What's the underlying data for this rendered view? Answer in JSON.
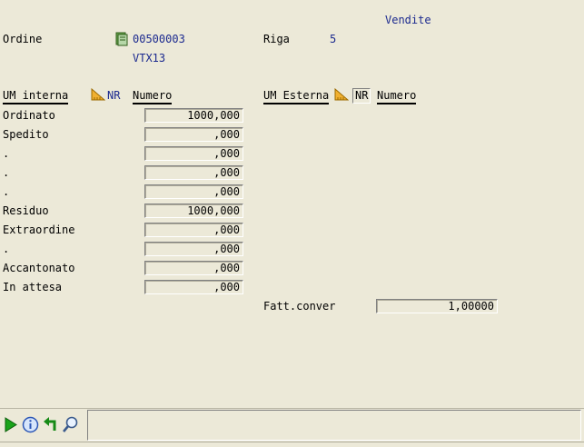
{
  "header": {
    "sales_label": "Vendite",
    "order_label": "Ordine",
    "order_number": "00500003",
    "order_code": "VTX13",
    "row_label": "Riga",
    "row_value": "5"
  },
  "columns": {
    "um_internal": "UM interna",
    "um_internal_code": "NR",
    "number_header": "Numero",
    "um_external": "UM Esterna",
    "um_external_code": "NR",
    "number_header_ext": "Numero"
  },
  "rows": [
    {
      "label": "Ordinato",
      "value": "1000,000"
    },
    {
      "label": "Spedito",
      "value": ",000"
    },
    {
      "label": ".",
      "value": ",000"
    },
    {
      "label": ".",
      "value": ",000"
    },
    {
      "label": ".",
      "value": ",000"
    },
    {
      "label": "Residuo",
      "value": "1000,000"
    },
    {
      "label": "Extraordine",
      "value": ",000"
    },
    {
      "label": ".",
      "value": ",000"
    },
    {
      "label": "Accantonato",
      "value": ",000"
    },
    {
      "label": "In attesa",
      "value": ",000"
    }
  ],
  "conversion": {
    "label": "Fatt.conver",
    "value": "1,00000"
  },
  "toolbar": {
    "icons": [
      "play-icon",
      "info-icon",
      "return-arrow-icon",
      "zoom-icon"
    ]
  },
  "colors": {
    "background": "#ece9d8",
    "accent_blue": "#1c2a8f",
    "icon_orange": "#e8a020"
  }
}
